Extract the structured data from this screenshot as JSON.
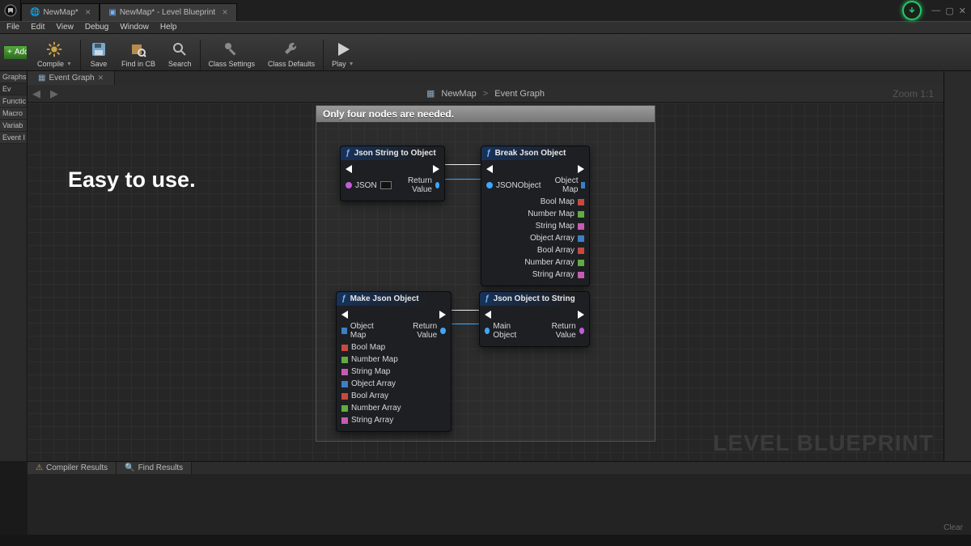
{
  "title_tabs": {
    "map": "NewMap*",
    "blueprint": "NewMap* - Level Blueprint"
  },
  "menu": {
    "file": "File",
    "edit": "Edit",
    "view": "View",
    "debug": "Debug",
    "window": "Window",
    "help": "Help"
  },
  "toolbar": {
    "addnew": "Add N",
    "compile": "Compile",
    "save": "Save",
    "find": "Find in CB",
    "search": "Search",
    "classsettings": "Class Settings",
    "classdefaults": "Class Defaults",
    "play": "Play"
  },
  "leftpanel": {
    "graphs": "Graphs",
    "ev": "Ev",
    "functions": "Functic",
    "macros": "Macro",
    "variables": "Variab",
    "events": "Event I"
  },
  "graph": {
    "tab": "Event Graph",
    "bc_map": "NewMap",
    "bc_sep": ">",
    "bc_graph": "Event Graph",
    "zoom": "Zoom 1:1",
    "watermark": "LEVEL BLUEPRINT",
    "promo": "Easy to use.",
    "comment": "Only four nodes are needed."
  },
  "nodes": {
    "jsto": {
      "title": "Json String to Object",
      "in_json": "JSON",
      "out_return": "Return Value"
    },
    "break": {
      "title": "Break Json Object",
      "in_obj": "JSONObject",
      "om": "Object Map",
      "bm": "Bool Map",
      "nm": "Number Map",
      "sm": "String Map",
      "oa": "Object Array",
      "ba": "Bool Array",
      "na": "Number Array",
      "sa": "String Array"
    },
    "make": {
      "title": "Make Json Object",
      "om": "Object Map",
      "bm": "Bool Map",
      "nm": "Number Map",
      "sm": "String Map",
      "oa": "Object Array",
      "ba": "Bool Array",
      "na": "Number Array",
      "sa": "String Array",
      "out_return": "Return Value"
    },
    "jots": {
      "title": "Json Object to String",
      "in_main": "Main Object",
      "out_return": "Return Value"
    }
  },
  "bottom": {
    "compiler": "Compiler Results",
    "find": "Find Results",
    "clear": "Clear"
  }
}
